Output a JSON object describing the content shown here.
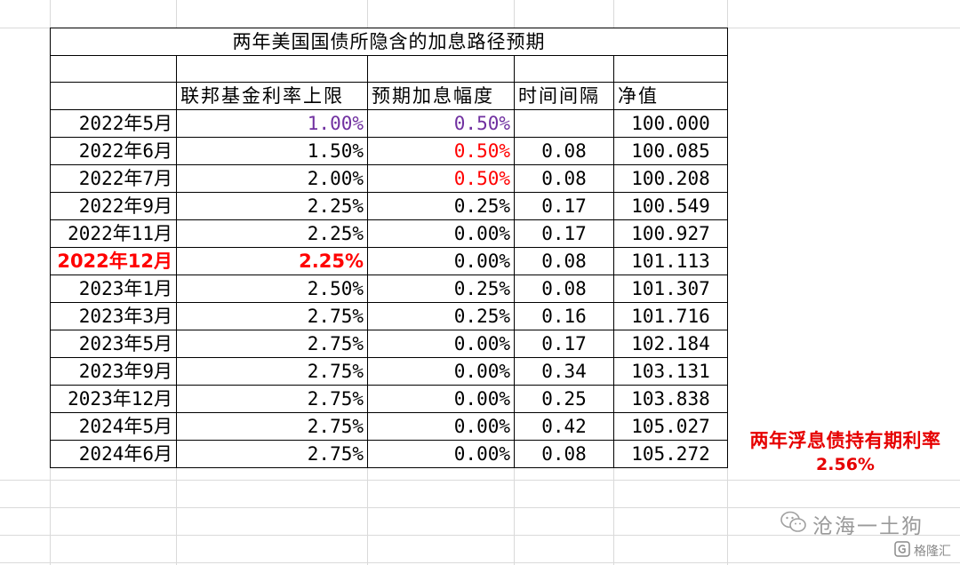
{
  "sheet": {
    "title": "两年美国国债所隐含的加息路径预期",
    "headers": [
      "",
      "联邦基金利率上限",
      "预期加息幅度",
      "时间间隔",
      "净值"
    ],
    "rows": [
      {
        "date": "2022年5月",
        "rate": "1.00%",
        "hike": "0.50%",
        "interval": "",
        "nav": "100.000"
      },
      {
        "date": "2022年6月",
        "rate": "1.50%",
        "hike": "0.50%",
        "interval": "0.08",
        "nav": "100.085"
      },
      {
        "date": "2022年7月",
        "rate": "2.00%",
        "hike": "0.50%",
        "interval": "0.08",
        "nav": "100.208"
      },
      {
        "date": "2022年9月",
        "rate": "2.25%",
        "hike": "0.25%",
        "interval": "0.17",
        "nav": "100.549"
      },
      {
        "date": "2022年11月",
        "rate": "2.25%",
        "hike": "0.00%",
        "interval": "0.17",
        "nav": "100.927"
      },
      {
        "date": "2022年12月",
        "rate": "2.25%",
        "hike": "0.00%",
        "interval": "0.08",
        "nav": "101.113"
      },
      {
        "date": "2023年1月",
        "rate": "2.50%",
        "hike": "0.25%",
        "interval": "0.08",
        "nav": "101.307"
      },
      {
        "date": "2023年3月",
        "rate": "2.75%",
        "hike": "0.25%",
        "interval": "0.16",
        "nav": "101.716"
      },
      {
        "date": "2023年5月",
        "rate": "2.75%",
        "hike": "0.00%",
        "interval": "0.17",
        "nav": "102.184"
      },
      {
        "date": "2023年9月",
        "rate": "2.75%",
        "hike": "0.00%",
        "interval": "0.34",
        "nav": "103.131"
      },
      {
        "date": "2023年12月",
        "rate": "2.75%",
        "hike": "0.00%",
        "interval": "0.25",
        "nav": "103.838"
      },
      {
        "date": "2024年5月",
        "rate": "2.75%",
        "hike": "0.00%",
        "interval": "0.42",
        "nav": "105.027"
      },
      {
        "date": "2024年6月",
        "rate": "2.75%",
        "hike": "0.00%",
        "interval": "0.08",
        "nav": "105.272"
      }
    ]
  },
  "note": {
    "label": "两年浮息债持有期利率",
    "value": "2.56%"
  },
  "watermark": {
    "author": "沧海一土狗",
    "source": "格隆汇"
  },
  "colors": {
    "purple": "#7030a0",
    "red": "#ff0000",
    "note_red": "#e60000",
    "gridline": "#dadada"
  }
}
